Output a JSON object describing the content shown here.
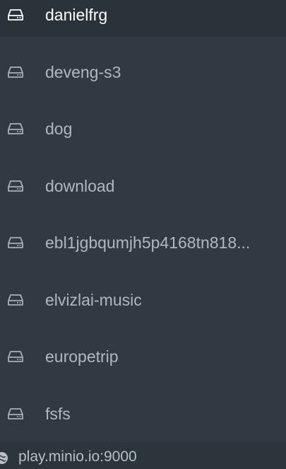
{
  "buckets": [
    {
      "name": "danielfrg",
      "active": true
    },
    {
      "name": "deveng-s3",
      "active": false
    },
    {
      "name": "dog",
      "active": false
    },
    {
      "name": "download",
      "active": false
    },
    {
      "name": "ebl1jgbqumjh5p4168tn818...",
      "active": false
    },
    {
      "name": "elvizlai-music",
      "active": false
    },
    {
      "name": "europetrip",
      "active": false
    },
    {
      "name": "fsfs",
      "active": false
    }
  ],
  "host": {
    "address": "play.minio.io:9000",
    "icon": "globe-icon"
  },
  "icons": {
    "bucket": "hdd-icon"
  },
  "colors": {
    "background": "#313a42",
    "active_background": "#2b333a",
    "text": "#b0b7bd",
    "active_text": "#ffffff"
  }
}
